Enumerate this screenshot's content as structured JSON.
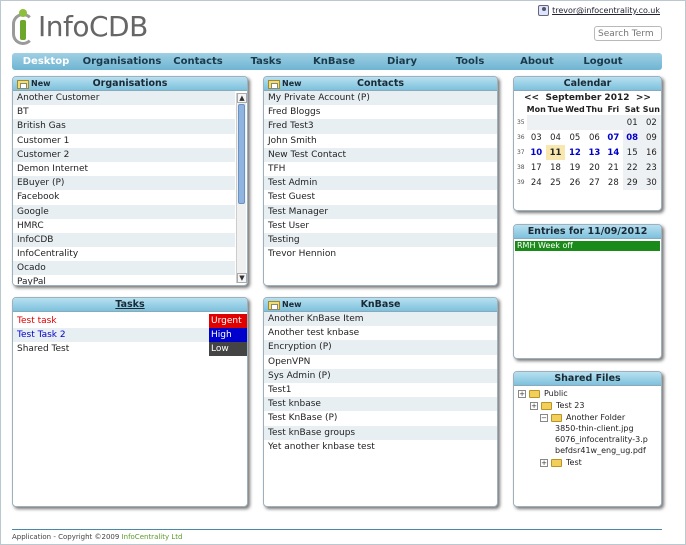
{
  "logo": {
    "text": "InfoCDB"
  },
  "user": {
    "email": "trevor@infocentrality.co.uk"
  },
  "search": {
    "placeholder": "Search Term"
  },
  "nav": [
    "Desktop",
    "Organisations",
    "Contacts",
    "Tasks",
    "KnBase",
    "Diary",
    "Tools",
    "About",
    "Logout"
  ],
  "organisations": {
    "title": "Organisations",
    "new_label": "New",
    "items": [
      "Another Customer",
      "BT",
      "British Gas",
      "Customer 1",
      "Customer 2",
      "Demon Internet",
      "EBuyer (P)",
      "Facebook",
      "Google",
      "HMRC",
      "InfoCDB",
      "InfoCentrality",
      "Ocado",
      "PayPal"
    ]
  },
  "contacts": {
    "title": "Contacts",
    "new_label": "New",
    "items": [
      "My Private Account (P)",
      "Fred Bloggs",
      "Fred Test3",
      "John Smith",
      "New Test Contact",
      "TFH",
      "Test Admin",
      "Test Guest",
      "Test Manager",
      "Test User",
      "Testing",
      "Trevor Hennion"
    ]
  },
  "tasks": {
    "title": "Tasks",
    "items": [
      {
        "name": "Test task",
        "priority": "Urgent",
        "name_color": "#e00000",
        "pri_color": "#e00000"
      },
      {
        "name": "Test Task 2",
        "priority": "High",
        "name_color": "#0000cc",
        "pri_color": "#0000cc"
      },
      {
        "name": "Shared Test",
        "priority": "Low",
        "name_color": "#222222",
        "pri_color": "#444444"
      }
    ]
  },
  "knbase": {
    "title": "KnBase",
    "new_label": "New",
    "items": [
      "Another KnBase Item",
      "Another test knbase",
      "Encryption (P)",
      "OpenVPN",
      "Sys Admin (P)",
      "Test1",
      "Test knbase",
      "Test KnBase (P)",
      "Test knBase groups",
      "Yet another knbase test"
    ]
  },
  "calendar": {
    "title": "Calendar",
    "prev": "<<",
    "next": ">>",
    "month": "September 2012",
    "days": [
      "Mon",
      "Tue",
      "Wed",
      "Thu",
      "Fri",
      "Sat",
      "Sun"
    ],
    "weeks": [
      {
        "wk": "35",
        "days": [
          "",
          "",
          "",
          "",
          "",
          "01",
          "02"
        ]
      },
      {
        "wk": "36",
        "days": [
          "03",
          "04",
          "05",
          "06",
          "07",
          "08",
          "09"
        ]
      },
      {
        "wk": "37",
        "days": [
          "10",
          "11",
          "12",
          "13",
          "14",
          "15",
          "16"
        ]
      },
      {
        "wk": "38",
        "days": [
          "17",
          "18",
          "19",
          "20",
          "21",
          "22",
          "23"
        ]
      },
      {
        "wk": "39",
        "days": [
          "24",
          "25",
          "26",
          "27",
          "28",
          "29",
          "30"
        ]
      }
    ],
    "busy_days": [
      "07",
      "08",
      "10",
      "12",
      "13",
      "14"
    ],
    "today": "11"
  },
  "entries": {
    "title": "Entries for 11/09/2012",
    "items": [
      "RMH Week off"
    ]
  },
  "shared_files": {
    "title": "Shared Files",
    "nodes": [
      {
        "label": "Public",
        "pm": "+",
        "folder": true
      },
      {
        "label": "Test 23",
        "pm": "+",
        "folder": true
      },
      {
        "label": "Another Folder",
        "pm": "−",
        "folder": true
      },
      {
        "label": "3850-thin-client.jpg",
        "pm": "",
        "folder": false
      },
      {
        "label": "6076_infocentrality-3.p",
        "pm": "",
        "folder": false
      },
      {
        "label": "befdsr41w_eng_ug.pdf",
        "pm": "",
        "folder": false
      },
      {
        "label": "Test",
        "pm": "+",
        "folder": true
      }
    ]
  },
  "footer": {
    "text": "Application - Copyright ©2009 ",
    "company": "InfoCentrality Ltd"
  }
}
